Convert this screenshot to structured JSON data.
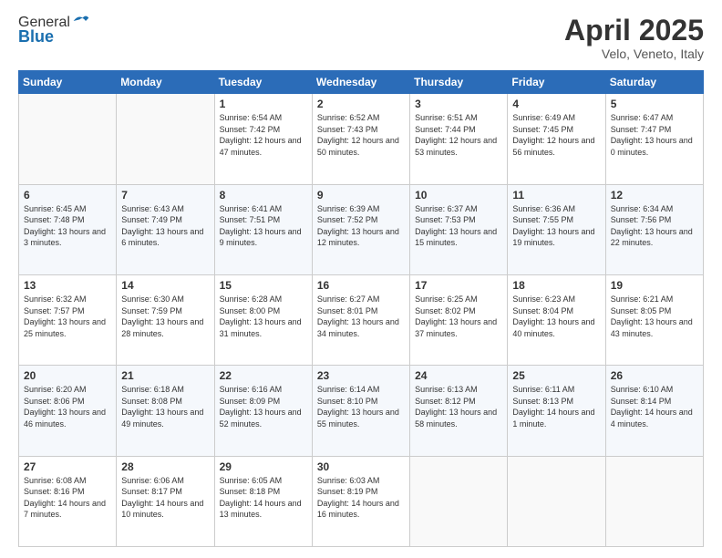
{
  "logo": {
    "general": "General",
    "blue": "Blue"
  },
  "header": {
    "title": "April 2025",
    "subtitle": "Velo, Veneto, Italy"
  },
  "weekdays": [
    "Sunday",
    "Monday",
    "Tuesday",
    "Wednesday",
    "Thursday",
    "Friday",
    "Saturday"
  ],
  "weeks": [
    [
      {
        "day": "",
        "sunrise": "",
        "sunset": "",
        "daylight": ""
      },
      {
        "day": "",
        "sunrise": "",
        "sunset": "",
        "daylight": ""
      },
      {
        "day": "1",
        "sunrise": "Sunrise: 6:54 AM",
        "sunset": "Sunset: 7:42 PM",
        "daylight": "Daylight: 12 hours and 47 minutes."
      },
      {
        "day": "2",
        "sunrise": "Sunrise: 6:52 AM",
        "sunset": "Sunset: 7:43 PM",
        "daylight": "Daylight: 12 hours and 50 minutes."
      },
      {
        "day": "3",
        "sunrise": "Sunrise: 6:51 AM",
        "sunset": "Sunset: 7:44 PM",
        "daylight": "Daylight: 12 hours and 53 minutes."
      },
      {
        "day": "4",
        "sunrise": "Sunrise: 6:49 AM",
        "sunset": "Sunset: 7:45 PM",
        "daylight": "Daylight: 12 hours and 56 minutes."
      },
      {
        "day": "5",
        "sunrise": "Sunrise: 6:47 AM",
        "sunset": "Sunset: 7:47 PM",
        "daylight": "Daylight: 13 hours and 0 minutes."
      }
    ],
    [
      {
        "day": "6",
        "sunrise": "Sunrise: 6:45 AM",
        "sunset": "Sunset: 7:48 PM",
        "daylight": "Daylight: 13 hours and 3 minutes."
      },
      {
        "day": "7",
        "sunrise": "Sunrise: 6:43 AM",
        "sunset": "Sunset: 7:49 PM",
        "daylight": "Daylight: 13 hours and 6 minutes."
      },
      {
        "day": "8",
        "sunrise": "Sunrise: 6:41 AM",
        "sunset": "Sunset: 7:51 PM",
        "daylight": "Daylight: 13 hours and 9 minutes."
      },
      {
        "day": "9",
        "sunrise": "Sunrise: 6:39 AM",
        "sunset": "Sunset: 7:52 PM",
        "daylight": "Daylight: 13 hours and 12 minutes."
      },
      {
        "day": "10",
        "sunrise": "Sunrise: 6:37 AM",
        "sunset": "Sunset: 7:53 PM",
        "daylight": "Daylight: 13 hours and 15 minutes."
      },
      {
        "day": "11",
        "sunrise": "Sunrise: 6:36 AM",
        "sunset": "Sunset: 7:55 PM",
        "daylight": "Daylight: 13 hours and 19 minutes."
      },
      {
        "day": "12",
        "sunrise": "Sunrise: 6:34 AM",
        "sunset": "Sunset: 7:56 PM",
        "daylight": "Daylight: 13 hours and 22 minutes."
      }
    ],
    [
      {
        "day": "13",
        "sunrise": "Sunrise: 6:32 AM",
        "sunset": "Sunset: 7:57 PM",
        "daylight": "Daylight: 13 hours and 25 minutes."
      },
      {
        "day": "14",
        "sunrise": "Sunrise: 6:30 AM",
        "sunset": "Sunset: 7:59 PM",
        "daylight": "Daylight: 13 hours and 28 minutes."
      },
      {
        "day": "15",
        "sunrise": "Sunrise: 6:28 AM",
        "sunset": "Sunset: 8:00 PM",
        "daylight": "Daylight: 13 hours and 31 minutes."
      },
      {
        "day": "16",
        "sunrise": "Sunrise: 6:27 AM",
        "sunset": "Sunset: 8:01 PM",
        "daylight": "Daylight: 13 hours and 34 minutes."
      },
      {
        "day": "17",
        "sunrise": "Sunrise: 6:25 AM",
        "sunset": "Sunset: 8:02 PM",
        "daylight": "Daylight: 13 hours and 37 minutes."
      },
      {
        "day": "18",
        "sunrise": "Sunrise: 6:23 AM",
        "sunset": "Sunset: 8:04 PM",
        "daylight": "Daylight: 13 hours and 40 minutes."
      },
      {
        "day": "19",
        "sunrise": "Sunrise: 6:21 AM",
        "sunset": "Sunset: 8:05 PM",
        "daylight": "Daylight: 13 hours and 43 minutes."
      }
    ],
    [
      {
        "day": "20",
        "sunrise": "Sunrise: 6:20 AM",
        "sunset": "Sunset: 8:06 PM",
        "daylight": "Daylight: 13 hours and 46 minutes."
      },
      {
        "day": "21",
        "sunrise": "Sunrise: 6:18 AM",
        "sunset": "Sunset: 8:08 PM",
        "daylight": "Daylight: 13 hours and 49 minutes."
      },
      {
        "day": "22",
        "sunrise": "Sunrise: 6:16 AM",
        "sunset": "Sunset: 8:09 PM",
        "daylight": "Daylight: 13 hours and 52 minutes."
      },
      {
        "day": "23",
        "sunrise": "Sunrise: 6:14 AM",
        "sunset": "Sunset: 8:10 PM",
        "daylight": "Daylight: 13 hours and 55 minutes."
      },
      {
        "day": "24",
        "sunrise": "Sunrise: 6:13 AM",
        "sunset": "Sunset: 8:12 PM",
        "daylight": "Daylight: 13 hours and 58 minutes."
      },
      {
        "day": "25",
        "sunrise": "Sunrise: 6:11 AM",
        "sunset": "Sunset: 8:13 PM",
        "daylight": "Daylight: 14 hours and 1 minute."
      },
      {
        "day": "26",
        "sunrise": "Sunrise: 6:10 AM",
        "sunset": "Sunset: 8:14 PM",
        "daylight": "Daylight: 14 hours and 4 minutes."
      }
    ],
    [
      {
        "day": "27",
        "sunrise": "Sunrise: 6:08 AM",
        "sunset": "Sunset: 8:16 PM",
        "daylight": "Daylight: 14 hours and 7 minutes."
      },
      {
        "day": "28",
        "sunrise": "Sunrise: 6:06 AM",
        "sunset": "Sunset: 8:17 PM",
        "daylight": "Daylight: 14 hours and 10 minutes."
      },
      {
        "day": "29",
        "sunrise": "Sunrise: 6:05 AM",
        "sunset": "Sunset: 8:18 PM",
        "daylight": "Daylight: 14 hours and 13 minutes."
      },
      {
        "day": "30",
        "sunrise": "Sunrise: 6:03 AM",
        "sunset": "Sunset: 8:19 PM",
        "daylight": "Daylight: 14 hours and 16 minutes."
      },
      {
        "day": "",
        "sunrise": "",
        "sunset": "",
        "daylight": ""
      },
      {
        "day": "",
        "sunrise": "",
        "sunset": "",
        "daylight": ""
      },
      {
        "day": "",
        "sunrise": "",
        "sunset": "",
        "daylight": ""
      }
    ]
  ]
}
